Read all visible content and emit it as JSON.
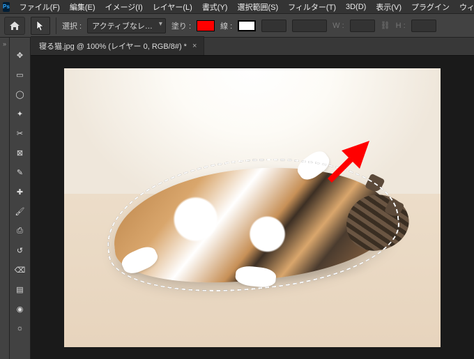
{
  "app": {
    "logo_text": "Ps"
  },
  "menu": {
    "items": [
      "ファイル(F)",
      "編集(E)",
      "イメージ(I)",
      "レイヤー(L)",
      "書式(Y)",
      "選択範囲(S)",
      "フィルター(T)",
      "3D(D)",
      "表示(V)",
      "プラグイン",
      "ウィンドウ(W)"
    ]
  },
  "options": {
    "select_label": "選択 :",
    "select_value": "アクティブなレ…",
    "fill_label": "塗り :",
    "fill_color": "#ff0000",
    "stroke_label": "線 :",
    "stroke_color": "#ffffff",
    "width_label": "W :",
    "height_label": "H :",
    "link_icon": "chain-icon"
  },
  "tools": {
    "items": [
      {
        "name": "move-tool",
        "glyph": "✥"
      },
      {
        "name": "marquee-tool",
        "glyph": "▭"
      },
      {
        "name": "lasso-tool",
        "glyph": "◯"
      },
      {
        "name": "magic-wand-tool",
        "glyph": "✦"
      },
      {
        "name": "crop-tool",
        "glyph": "✂"
      },
      {
        "name": "frame-tool",
        "glyph": "⊠"
      },
      {
        "name": "eyedropper-tool",
        "glyph": "✎"
      },
      {
        "name": "healing-brush-tool",
        "glyph": "✚"
      },
      {
        "name": "brush-tool",
        "glyph": "🖌"
      },
      {
        "name": "clone-stamp-tool",
        "glyph": "⎙"
      },
      {
        "name": "history-brush-tool",
        "glyph": "↺"
      },
      {
        "name": "eraser-tool",
        "glyph": "⌫"
      },
      {
        "name": "gradient-tool",
        "glyph": "▤"
      },
      {
        "name": "blur-tool",
        "glyph": "◉"
      },
      {
        "name": "dodge-tool",
        "glyph": "☼"
      }
    ]
  },
  "document": {
    "tab_title": "寝る猫.jpg @ 100% (レイヤー 0, RGB/8#) *",
    "close_glyph": "×"
  },
  "panels_handle": "»"
}
